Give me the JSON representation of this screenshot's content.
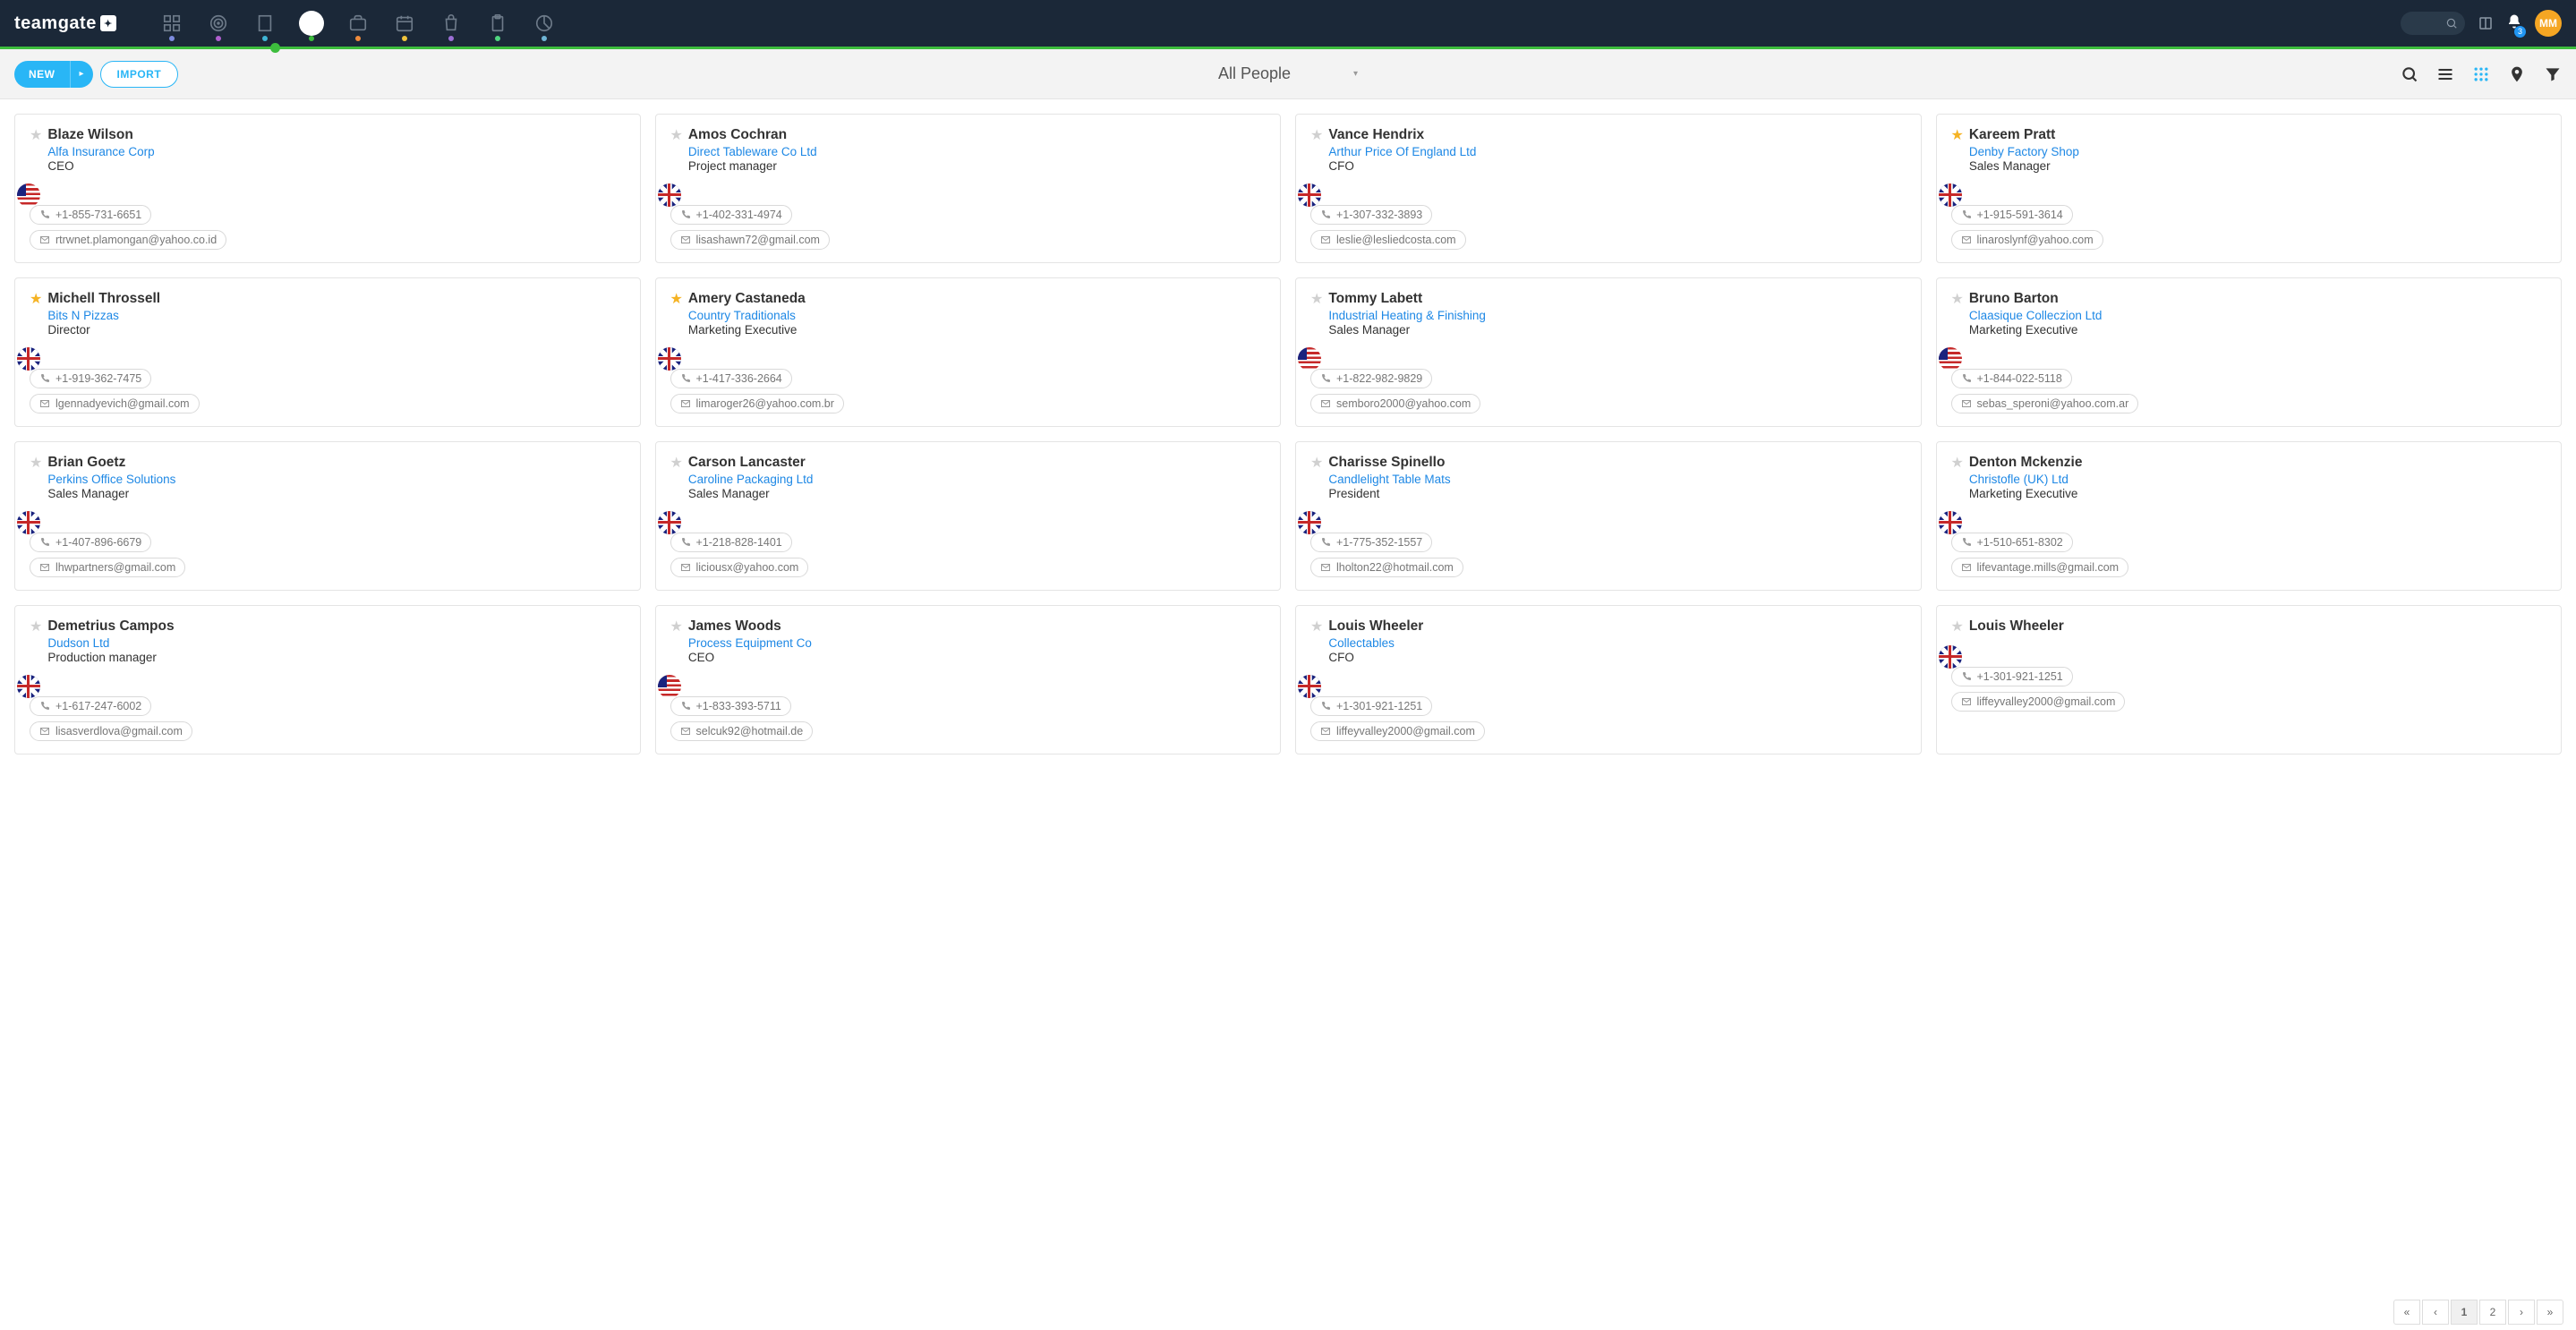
{
  "brand": "teamgate",
  "navbar": {
    "modules": [
      {
        "name": "dashboard-icon",
        "dot": "#7e8ce0"
      },
      {
        "name": "target-icon",
        "dot": "#b05fcf"
      },
      {
        "name": "building-icon",
        "dot": "#3fb5d6"
      },
      {
        "name": "people-icon",
        "dot": "#3dbd3d",
        "active": true
      },
      {
        "name": "briefcase-icon",
        "dot": "#f08b3c"
      },
      {
        "name": "calendar-icon",
        "dot": "#f0c43c"
      },
      {
        "name": "shopping-icon",
        "dot": "#9c6fd6"
      },
      {
        "name": "clipboard-icon",
        "dot": "#4fd67f"
      },
      {
        "name": "chart-icon",
        "dot": "#6fb5d6"
      }
    ],
    "notifications": "3",
    "avatar_initials": "MM"
  },
  "toolbar": {
    "new_label": "NEW",
    "import_label": "IMPORT",
    "title": "All People"
  },
  "people": [
    {
      "name": "Blaze Wilson",
      "company": "Alfa Insurance Corp",
      "role": "CEO",
      "phone": "+1-855-731-6651",
      "email": "rtrwnet.plamongan@yahoo.co.id",
      "flag": "us",
      "fav": false
    },
    {
      "name": "Amos Cochran",
      "company": "Direct Tableware Co Ltd",
      "role": "Project manager",
      "phone": "+1-402-331-4974",
      "email": "lisashawn72@gmail.com",
      "flag": "uk",
      "fav": false
    },
    {
      "name": "Vance Hendrix",
      "company": "Arthur Price Of England Ltd",
      "role": "CFO",
      "phone": "+1-307-332-3893",
      "email": "leslie@lesliedcosta.com",
      "flag": "uk",
      "fav": false
    },
    {
      "name": "Kareem Pratt",
      "company": "Denby Factory Shop",
      "role": "Sales Manager",
      "phone": "+1-915-591-3614",
      "email": "linaroslynf@yahoo.com",
      "flag": "uk",
      "fav": true
    },
    {
      "name": "Michell Throssell",
      "company": "Bits N Pizzas",
      "role": "Director",
      "phone": "+1-919-362-7475",
      "email": "lgennadyevich@gmail.com",
      "flag": "uk",
      "fav": true
    },
    {
      "name": "Amery Castaneda",
      "company": "Country Traditionals",
      "role": "Marketing Executive",
      "phone": "+1-417-336-2664",
      "email": "limaroger26@yahoo.com.br",
      "flag": "uk",
      "fav": true
    },
    {
      "name": "Tommy Labett",
      "company": "Industrial Heating & Finishing",
      "role": "Sales Manager",
      "phone": "+1-822-982-9829",
      "email": "semboro2000@yahoo.com",
      "flag": "us",
      "fav": false
    },
    {
      "name": "Bruno Barton",
      "company": "Claasique Colleczion Ltd",
      "role": "Marketing Executive",
      "phone": "+1-844-022-5118",
      "email": "sebas_speroni@yahoo.com.ar",
      "flag": "us",
      "fav": false
    },
    {
      "name": "Brian Goetz",
      "company": "Perkins Office Solutions",
      "role": "Sales Manager",
      "phone": "+1-407-896-6679",
      "email": "lhwpartners@gmail.com",
      "flag": "uk",
      "fav": false
    },
    {
      "name": "Carson Lancaster",
      "company": "Caroline Packaging Ltd",
      "role": "Sales Manager",
      "phone": "+1-218-828-1401",
      "email": "liciousx@yahoo.com",
      "flag": "uk",
      "fav": false
    },
    {
      "name": "Charisse Spinello",
      "company": "Candlelight Table Mats",
      "role": "President",
      "phone": "+1-775-352-1557",
      "email": "lholton22@hotmail.com",
      "flag": "uk",
      "fav": false
    },
    {
      "name": "Denton Mckenzie",
      "company": "Christofle (UK) Ltd",
      "role": "Marketing Executive",
      "phone": "+1-510-651-8302",
      "email": "lifevantage.mills@gmail.com",
      "flag": "uk",
      "fav": false
    },
    {
      "name": "Demetrius Campos",
      "company": "Dudson Ltd",
      "role": "Production manager",
      "phone": "+1-617-247-6002",
      "email": "lisasverdlova@gmail.com",
      "flag": "uk",
      "fav": false
    },
    {
      "name": "James Woods",
      "company": "Process Equipment Co",
      "role": "CEO",
      "phone": "+1-833-393-5711",
      "email": "selcuk92@hotmail.de",
      "flag": "us",
      "fav": false
    },
    {
      "name": "Louis Wheeler",
      "company": "Collectables",
      "role": "CFO",
      "phone": "+1-301-921-1251",
      "email": "liffeyvalley2000@gmail.com",
      "flag": "uk",
      "fav": false
    },
    {
      "name": "Louis Wheeler",
      "company": "",
      "role": "",
      "phone": "+1-301-921-1251",
      "email": "liffeyvalley2000@gmail.com",
      "flag": "uk",
      "fav": false
    }
  ],
  "pagination": {
    "pages": [
      "«",
      "‹",
      "1",
      "2",
      "›",
      "»"
    ],
    "active": "1"
  }
}
